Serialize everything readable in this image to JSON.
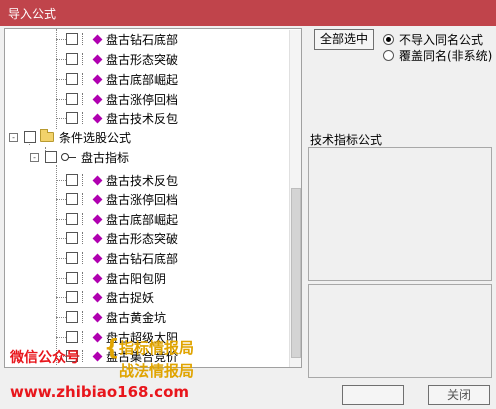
{
  "window": {
    "title": "导入公式"
  },
  "tree": {
    "top_items": [
      "盘古钻石底部",
      "盘古形态突破",
      "盘古底部崛起",
      "盘古涨停回档",
      "盘古技术反包"
    ],
    "group": {
      "label": "条件选股公式",
      "expander": "-"
    },
    "subgroup": {
      "label": "盘古指标",
      "expander": "-"
    },
    "sub_items": [
      "盘古技术反包",
      "盘古涨停回档",
      "盘古底部崛起",
      "盘古形态突破",
      "盘古钻石底部",
      "盘古阳包阴",
      "盘古捉妖",
      "盘古黄金坑",
      "盘古超级太阳",
      "盘古集合竞价"
    ]
  },
  "controls": {
    "select_all_label": "全部选中",
    "radio_options": [
      {
        "label": "不导入同名公式",
        "selected": true
      },
      {
        "label": "覆盖同名(非系统)",
        "selected": false
      }
    ],
    "section_label": "技术指标公式",
    "bottom_right_button": "关闭"
  },
  "watermark": {
    "wechat": "微信公众号",
    "brand_top": "指标情报局",
    "brand_bottom": "战法情报局",
    "url": "www.zhibiao168.com"
  },
  "colors": {
    "titlebar": "#c0444b",
    "diamond": "#b000b0",
    "watermark_red": "#e8161c",
    "watermark_gold": "#e0a400"
  }
}
